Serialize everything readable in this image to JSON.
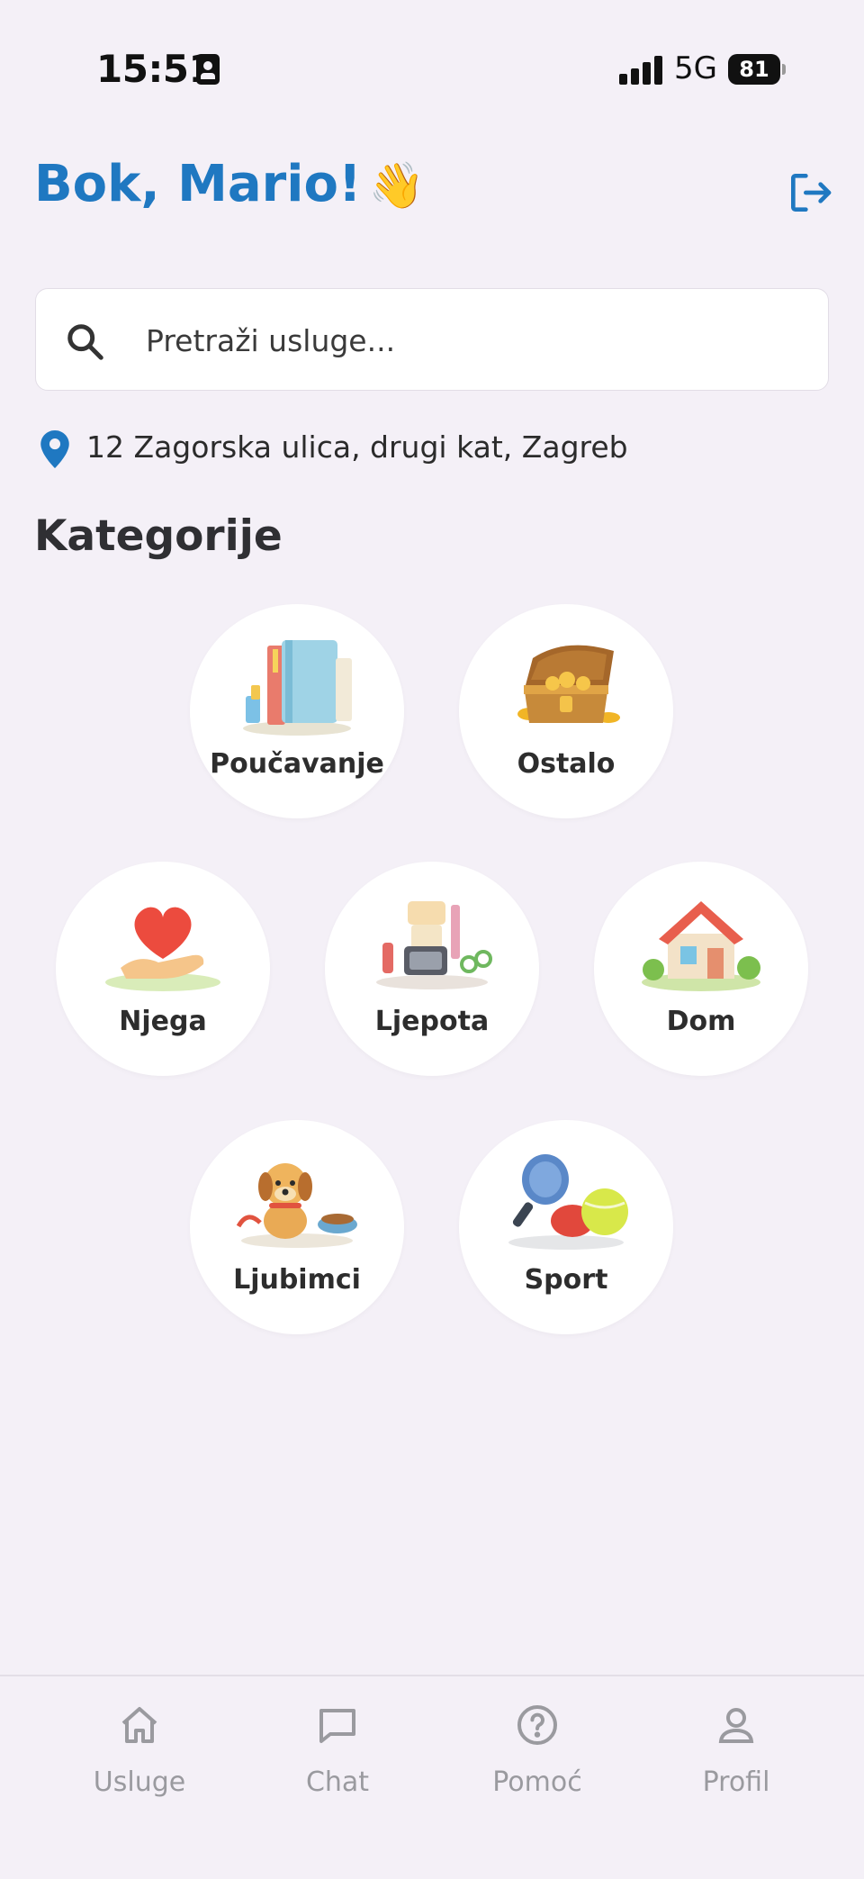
{
  "status_bar": {
    "time": "15:51",
    "network": "5G",
    "battery": "81"
  },
  "header": {
    "greeting": "Bok, Mario!",
    "wave_emoji": "👋"
  },
  "search": {
    "placeholder": "Pretraži usluge..."
  },
  "location": {
    "address": "12 Zagorska ulica, drugi kat, Zagreb"
  },
  "categories_title": "Kategorije",
  "categories": [
    {
      "label": "Poučavanje",
      "icon": "books-icon"
    },
    {
      "label": "Ostalo",
      "icon": "treasure-chest-icon"
    },
    {
      "label": "Njega",
      "icon": "heart-hand-icon"
    },
    {
      "label": "Ljepota",
      "icon": "beauty-kit-icon"
    },
    {
      "label": "Dom",
      "icon": "house-icon"
    },
    {
      "label": "Ljubimci",
      "icon": "dog-icon"
    },
    {
      "label": "Sport",
      "icon": "sports-icon"
    }
  ],
  "bottom_nav": [
    {
      "label": "Usluge",
      "icon": "home-icon"
    },
    {
      "label": "Chat",
      "icon": "chat-icon"
    },
    {
      "label": "Pomoć",
      "icon": "help-icon"
    },
    {
      "label": "Profil",
      "icon": "profile-icon"
    }
  ],
  "colors": {
    "accent": "#1f78c1",
    "background": "#f4f0f7",
    "inactive_nav": "#9a9a9f"
  }
}
